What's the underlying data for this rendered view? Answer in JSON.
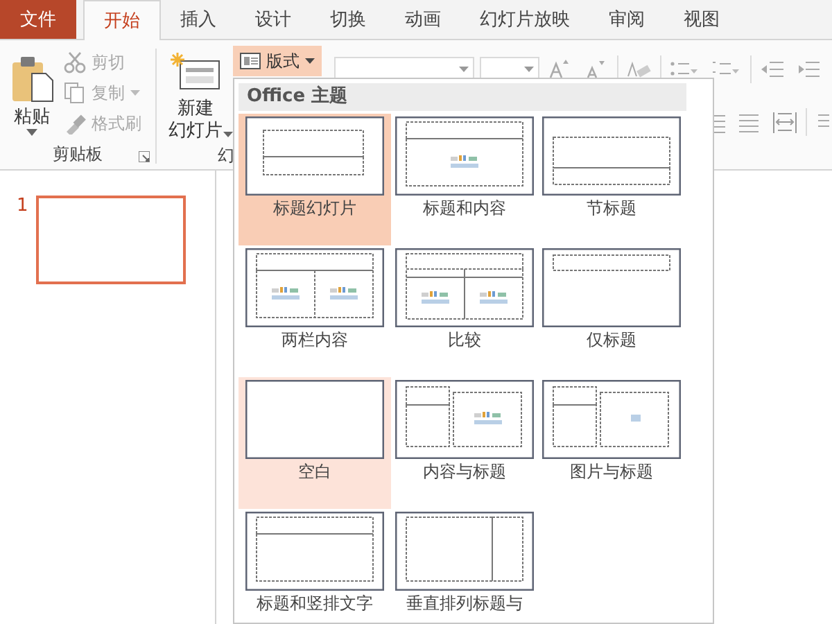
{
  "tabs": [
    {
      "label": "文件",
      "kind": "file",
      "selected": false
    },
    {
      "label": "开始",
      "kind": "tab",
      "selected": true
    },
    {
      "label": "插入",
      "kind": "tab",
      "selected": false
    },
    {
      "label": "设计",
      "kind": "tab",
      "selected": false
    },
    {
      "label": "切换",
      "kind": "tab",
      "selected": false
    },
    {
      "label": "动画",
      "kind": "tab",
      "selected": false
    },
    {
      "label": "幻灯片放映",
      "kind": "tab",
      "selected": false
    },
    {
      "label": "审阅",
      "kind": "tab",
      "selected": false
    },
    {
      "label": "视图",
      "kind": "tab",
      "selected": false
    }
  ],
  "clipboard": {
    "paste": "粘贴",
    "small_buttons": [
      {
        "label": "剪切",
        "kind": "cut",
        "disabled": true
      },
      {
        "label": "复制",
        "kind": "copy",
        "disabled": true
      },
      {
        "label": "格式刷",
        "kind": "brush",
        "disabled": true
      }
    ],
    "group_label": "剪贴板"
  },
  "slides_group": {
    "new_slide": [
      "新建",
      "幻灯片"
    ],
    "group_label": "幻",
    "layout_button": {
      "label": "版式",
      "pressed": true
    }
  },
  "layout_menu": {
    "header": "Office 主题",
    "layouts": [
      {
        "label": "标题幻灯片",
        "kind": "title",
        "selected": true,
        "hovered": false
      },
      {
        "label": "标题和内容",
        "kind": "title-content",
        "selected": false,
        "hovered": false
      },
      {
        "label": "节标题",
        "kind": "section",
        "selected": false,
        "hovered": false
      },
      {
        "label": "两栏内容",
        "kind": "two-content",
        "selected": false,
        "hovered": false
      },
      {
        "label": "比较",
        "kind": "comparison",
        "selected": false,
        "hovered": false
      },
      {
        "label": "仅标题",
        "kind": "title-only",
        "selected": false,
        "hovered": false
      },
      {
        "label": "空白",
        "kind": "blank",
        "selected": false,
        "hovered": true
      },
      {
        "label": "内容与标题",
        "kind": "content-caption",
        "selected": false,
        "hovered": false
      },
      {
        "label": "图片与标题",
        "kind": "picture-caption",
        "selected": false,
        "hovered": false
      },
      {
        "label": "标题和竖排文字",
        "kind": "title-vertical",
        "selected": false,
        "hovered": false
      },
      {
        "label": "垂直排列标题与",
        "kind": "vertical-title",
        "selected": false,
        "hovered": false
      }
    ]
  },
  "slides": [
    {
      "number": "1",
      "selected": true
    }
  ]
}
